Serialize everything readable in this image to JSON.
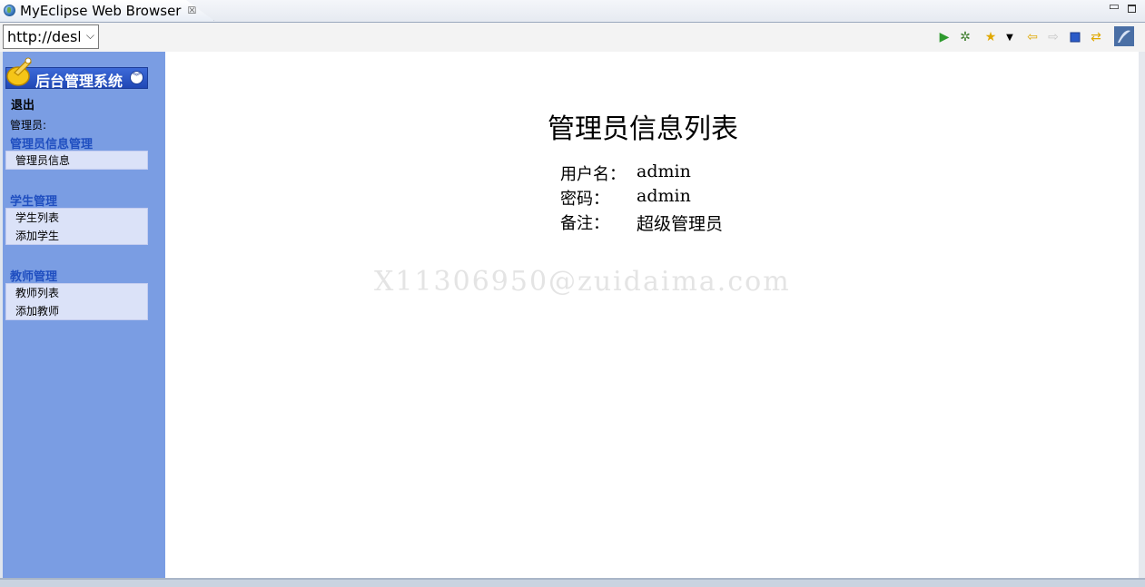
{
  "tab": {
    "title": "MyEclipse Web Browser",
    "close": "☒"
  },
  "toolbar": {
    "url": "http://desk",
    "icons": [
      "run-icon",
      "debug-icon",
      "favorites-icon",
      "dropdown-icon",
      "back-icon",
      "forward-icon",
      "stop-icon",
      "refresh-icon",
      "myeclipse-icon"
    ]
  },
  "sidebar": {
    "system_title": "后台管理系统",
    "logout": "退出",
    "admin_label": "管理员:",
    "groups": [
      {
        "title": "管理员信息管理",
        "items": [
          "管理员信息"
        ]
      },
      {
        "title": "学生管理",
        "items": [
          "学生列表",
          "添加学生"
        ]
      },
      {
        "title": "教师管理",
        "items": [
          "教师列表",
          "添加教师"
        ]
      }
    ]
  },
  "main": {
    "title": "管理员信息列表",
    "rows": [
      {
        "label": "用户名：",
        "value": "admin"
      },
      {
        "label": "密码：",
        "value": "admin"
      },
      {
        "label": "备注：",
        "value": "超级管理员"
      }
    ],
    "watermark": "X11306950@zuidaima.com"
  },
  "colors": {
    "sidebar_bg": "#7a9de3",
    "header_bg": "#2048b5",
    "group_title": "#1f4ec0",
    "group_box": "#dbe2f8"
  }
}
